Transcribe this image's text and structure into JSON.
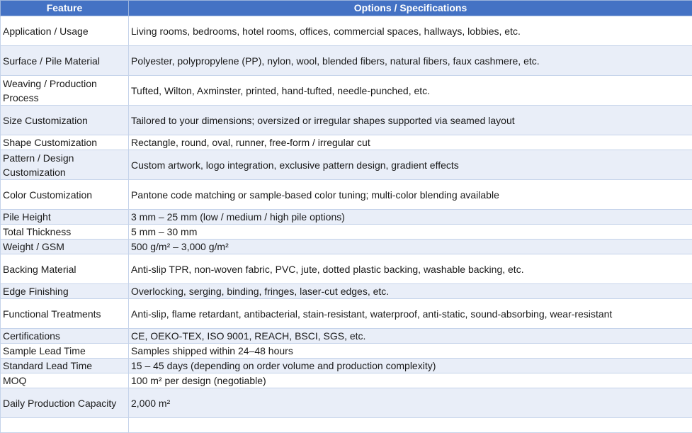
{
  "table": {
    "headers": [
      "Feature",
      "Options / Specifications"
    ],
    "rows": [
      {
        "feature": "Application / Usage",
        "value": "Living rooms, bedrooms, hotel rooms, offices, commercial spaces, hallways, lobbies, etc."
      },
      {
        "feature": "Surface / Pile Material",
        "value": "Polyester, polypropylene (PP), nylon, wool, blended fibers, natural fibers, faux cashmere, etc."
      },
      {
        "feature": "Weaving / Production Process",
        "value": "Tufted, Wilton, Axminster, printed, hand-tufted, needle-punched, etc."
      },
      {
        "feature": "Size Customization",
        "value": "Tailored to your dimensions; oversized or irregular shapes supported via seamed layout"
      },
      {
        "feature": "Shape Customization",
        "value": "Rectangle, round, oval, runner, free-form / irregular cut"
      },
      {
        "feature": "Pattern / Design Customization",
        "value": "Custom artwork, logo integration, exclusive pattern design, gradient effects"
      },
      {
        "feature": "Color Customization",
        "value": "Pantone code matching or sample-based color tuning; multi-color blending available"
      },
      {
        "feature": "Pile Height",
        "value": "3 mm – 25 mm (low / medium / high pile options)"
      },
      {
        "feature": "Total Thickness",
        "value": "5 mm – 30 mm"
      },
      {
        "feature": "Weight / GSM",
        "value": "500 g/m² – 3,000 g/m²"
      },
      {
        "feature": "Backing Material",
        "value": "Anti-slip TPR, non-woven fabric, PVC, jute, dotted plastic backing, washable backing, etc."
      },
      {
        "feature": "Edge Finishing",
        "value": "Overlocking, serging, binding, fringes, laser-cut edges, etc."
      },
      {
        "feature": "Functional Treatments",
        "value": "Anti-slip, flame retardant, antibacterial, stain-resistant, waterproof, anti-static, sound-absorbing, wear-resistant"
      },
      {
        "feature": "Certifications",
        "value": "CE, OEKO-TEX, ISO 9001, REACH, BSCI, SGS, etc."
      },
      {
        "feature": "Sample Lead Time",
        "value": "Samples shipped within 24–48 hours"
      },
      {
        "feature": "Standard Lead Time",
        "value": "15 – 45 days (depending on order volume and production complexity)"
      },
      {
        "feature": "MOQ",
        "value": "100 m² per design (negotiable)"
      },
      {
        "feature": "Daily Production Capacity",
        "value": "2,000 m²"
      },
      {
        "feature": "",
        "value": ""
      }
    ]
  }
}
